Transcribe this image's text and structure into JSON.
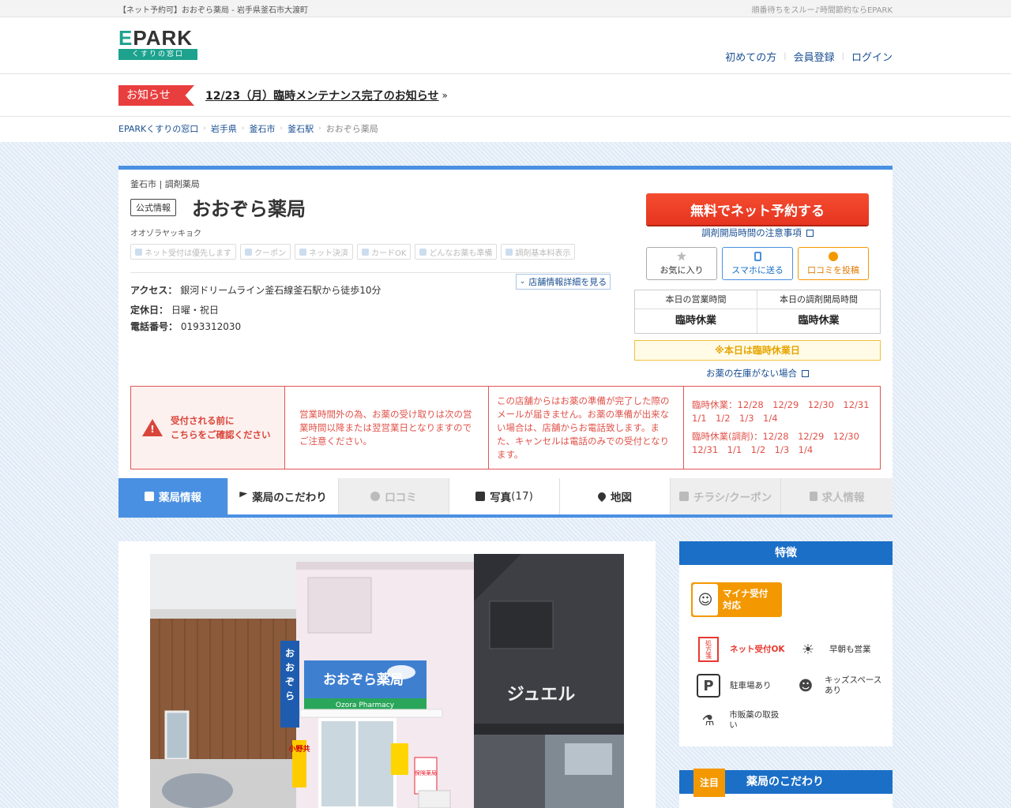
{
  "page": {
    "top_title": "【ネット予約可】おおぞら薬局 - 岩手県釜石市大渡町",
    "top_tagline": "順番待ちをスルー♪時間節約ならEPARK"
  },
  "header": {
    "logo_main": "EPARK",
    "logo_sub": "くすりの窓口",
    "nav": [
      "初めての方",
      "会員登録",
      "ログイン"
    ],
    "brand_color": "#1da28e"
  },
  "notice": {
    "badge": "お知らせ",
    "text": "12/23（月）臨時メンテナンス完了のお知らせ"
  },
  "breadcrumb": [
    "EPARKくすりの窓口",
    "岩手県",
    "釜石市",
    "釜石駅",
    "おおぞら薬局"
  ],
  "shop": {
    "category": "釜石市 | 調剤薬局",
    "official_badge": "公式情報",
    "name": "おおぞら薬局",
    "kana": "オオゾラヤッキョク",
    "features": [
      "ネット受付は優先します",
      "クーポン",
      "ネット決済",
      "カードOK",
      "どんなお薬も準備",
      "調剤基本料表示"
    ],
    "detail_button": "店舗情報詳細を見る",
    "access_label": "アクセス：",
    "access_value": "銀河ドリームライン釜石線釜石駅から徒歩10分",
    "holiday_label": "定休日：",
    "holiday_value": "日曜・祝日",
    "phone_label": "電話番号：",
    "phone_value": "0193312030"
  },
  "actions": {
    "reserve": "無料でネット予約する",
    "note_link": "調剤開局時間の注意事項",
    "favorite": "お気に入り",
    "send_phone": "スマホに送る",
    "review": "口コミを投稿",
    "hours_label": "本日の営業時間",
    "hours_value": "臨時休業",
    "dispensing_label": "本日の調剤開局時間",
    "dispensing_value": "臨時休業",
    "closed_notice": "※本日は臨時休業日",
    "stock_link": "お薬の在庫がない場合"
  },
  "warning": {
    "head": [
      "受付される前に",
      "こちらをご確認ください"
    ],
    "col1": "営業時間外の為、お薬の受け取りは次の営業時間以降または翌営業日となりますのでご注意ください。",
    "col2": "この店舗からはお薬の準備が完了した際のメールが届きません。お薬の準備が出来ない場合は、店舗からお電話致します。また、キャンセルは電話のみでの受付となります。",
    "closed_days": "臨時休業：12/28　12/29　12/30　12/31　1/1　1/2　1/3　1/4",
    "closed_dispensing": "臨時休業(調剤)：12/28　12/29　12/30　12/31　1/1　1/2　1/3　1/4"
  },
  "tabs": [
    {
      "label": "薬局情報",
      "state": "active"
    },
    {
      "label": "薬局のこだわり",
      "state": "normal"
    },
    {
      "label": "口コミ",
      "state": "disabled"
    },
    {
      "label": "写真",
      "count": "(17)",
      "state": "normal"
    },
    {
      "label": "地図",
      "state": "normal"
    },
    {
      "label": "チラシ/クーポン",
      "state": "disabled"
    },
    {
      "label": "求人情報",
      "state": "disabled"
    }
  ],
  "photo": {
    "sign_main": "おおぞら薬局",
    "sign_sub": "Ozora Pharmacy",
    "side_sign": "おおぞら薬局",
    "neighbor_sign": "ジュエル",
    "small_sign": "保険薬局",
    "vertical_sign": "小野共"
  },
  "sidebar": {
    "features_title": "特徴",
    "myna": [
      "マイナ受付",
      "対応"
    ],
    "items": [
      {
        "icon": "prescription-icon",
        "text": "ネット受付OK",
        "highlight": true
      },
      {
        "icon": "sun-icon",
        "text": "早朝も営業",
        "highlight": false
      },
      {
        "icon": "parking-icon",
        "text": "駐車場あり",
        "highlight": false
      },
      {
        "icon": "child-icon",
        "text": "キッズスペースあり",
        "highlight": false
      },
      {
        "icon": "medicine-icon",
        "text": "市販薬の取扱い",
        "highlight": false
      }
    ],
    "rx_icon_text": "処方箋",
    "parking_icon_text": "P",
    "commitment_tag": "注目",
    "commitment_title": "薬局のこだわり"
  }
}
